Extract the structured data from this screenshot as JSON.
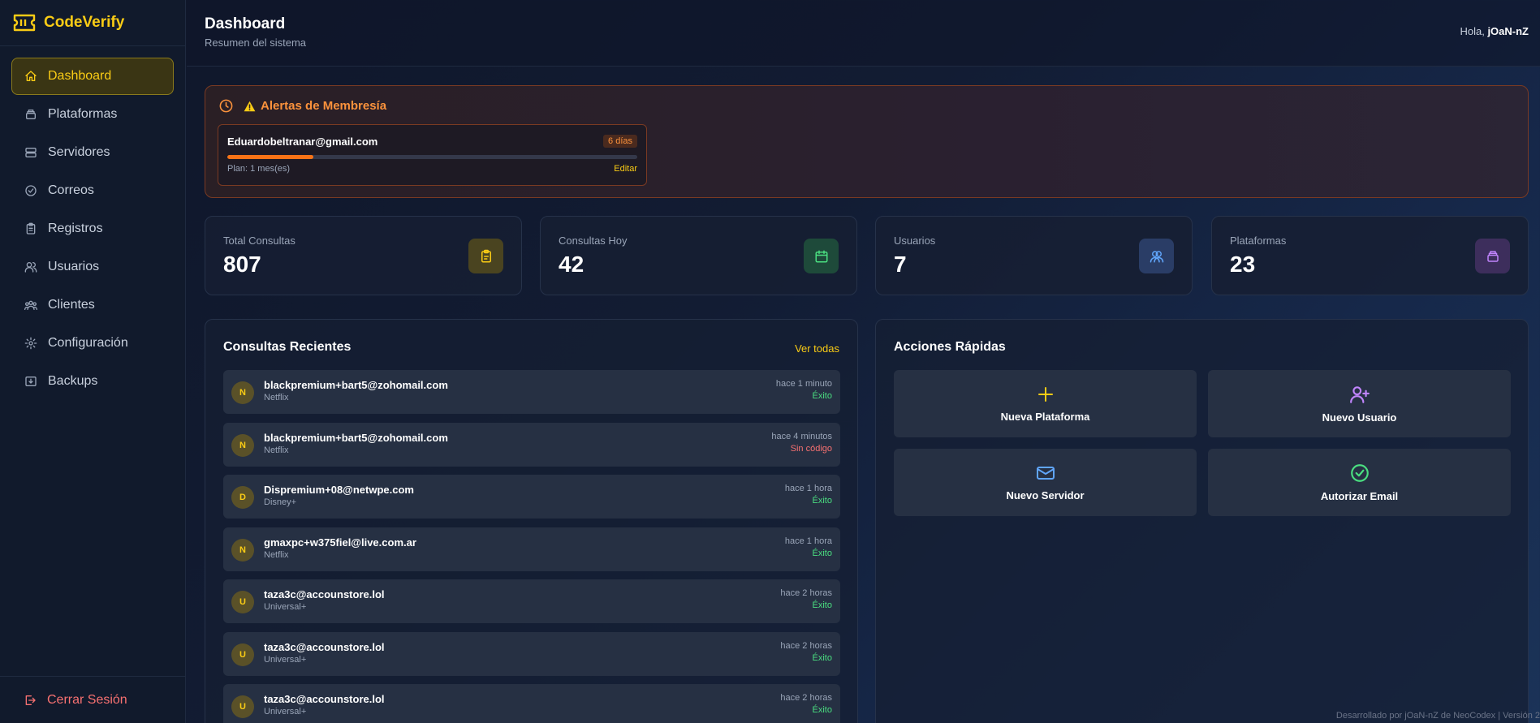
{
  "app": {
    "name": "CodeVerify"
  },
  "sidebar": {
    "items": [
      {
        "label": "Dashboard",
        "icon": "home-icon",
        "active": true
      },
      {
        "label": "Plataformas",
        "icon": "layers-icon",
        "active": false
      },
      {
        "label": "Servidores",
        "icon": "server-icon",
        "active": false
      },
      {
        "label": "Correos",
        "icon": "check-circle-icon",
        "active": false
      },
      {
        "label": "Registros",
        "icon": "clipboard-icon",
        "active": false
      },
      {
        "label": "Usuarios",
        "icon": "users-icon",
        "active": false
      },
      {
        "label": "Clientes",
        "icon": "group-icon",
        "active": false
      },
      {
        "label": "Configuración",
        "icon": "gear-icon",
        "active": false
      },
      {
        "label": "Backups",
        "icon": "download-icon",
        "active": false
      }
    ],
    "logout_label": "Cerrar Sesión"
  },
  "header": {
    "title": "Dashboard",
    "subtitle": "Resumen del sistema",
    "greeting": "Hola,",
    "username": "jOaN-nZ"
  },
  "alerts": {
    "title": "Alertas de Membresía",
    "card": {
      "email": "Eduardobeltranar@gmail.com",
      "days": "6 días",
      "plan": "Plan: 1 mes(es)",
      "edit_label": "Editar",
      "progress": 0.21
    }
  },
  "stats": [
    {
      "label": "Total Consultas",
      "value": "807",
      "icon": "clipboard-icon",
      "color": "#facc15",
      "bg": "#4a4420"
    },
    {
      "label": "Consultas Hoy",
      "value": "42",
      "icon": "calendar-icon",
      "color": "#4ade80",
      "bg": "#1e4a3a"
    },
    {
      "label": "Usuarios",
      "value": "7",
      "icon": "users-icon",
      "color": "#60a5fa",
      "bg": "#2a3d66"
    },
    {
      "label": "Plataformas",
      "value": "23",
      "icon": "layers-icon",
      "color": "#c084fc",
      "bg": "#3d2e5c"
    }
  ],
  "recent": {
    "title": "Consultas Recientes",
    "see_all": "Ver todas",
    "rows": [
      {
        "initial": "N",
        "email": "blackpremium+bart5@zohomail.com",
        "platform": "Netflix",
        "time": "hace 1 minuto",
        "status": "Éxito",
        "ok": true
      },
      {
        "initial": "N",
        "email": "blackpremium+bart5@zohomail.com",
        "platform": "Netflix",
        "time": "hace 4 minutos",
        "status": "Sin código",
        "ok": false
      },
      {
        "initial": "D",
        "email": "Dispremium+08@netwpe.com",
        "platform": "Disney+",
        "time": "hace 1 hora",
        "status": "Éxito",
        "ok": true
      },
      {
        "initial": "N",
        "email": "gmaxpc+w375fiel@live.com.ar",
        "platform": "Netflix",
        "time": "hace 1 hora",
        "status": "Éxito",
        "ok": true
      },
      {
        "initial": "U",
        "email": "taza3c@accounstore.lol",
        "platform": "Universal+",
        "time": "hace 2 horas",
        "status": "Éxito",
        "ok": true
      },
      {
        "initial": "U",
        "email": "taza3c@accounstore.lol",
        "platform": "Universal+",
        "time": "hace 2 horas",
        "status": "Éxito",
        "ok": true
      },
      {
        "initial": "U",
        "email": "taza3c@accounstore.lol",
        "platform": "Universal+",
        "time": "hace 2 horas",
        "status": "Éxito",
        "ok": true
      }
    ]
  },
  "quick_actions": {
    "title": "Acciones Rápidas",
    "items": [
      {
        "label": "Nueva Plataforma",
        "icon": "plus-icon",
        "color": "#facc15"
      },
      {
        "label": "Nuevo Usuario",
        "icon": "user-plus-icon",
        "color": "#c084fc"
      },
      {
        "label": "Nuevo Servidor",
        "icon": "mail-icon",
        "color": "#60a5fa"
      },
      {
        "label": "Autorizar Email",
        "icon": "check-circle-icon",
        "color": "#4ade80"
      }
    ]
  },
  "footer": {
    "text": "Desarrollado por jOaN-nZ de NeoCodex | Versión 2"
  },
  "colors": {
    "accent": "#facc15",
    "success": "#4ade80",
    "danger": "#f87171",
    "warning": "#fb923c"
  }
}
